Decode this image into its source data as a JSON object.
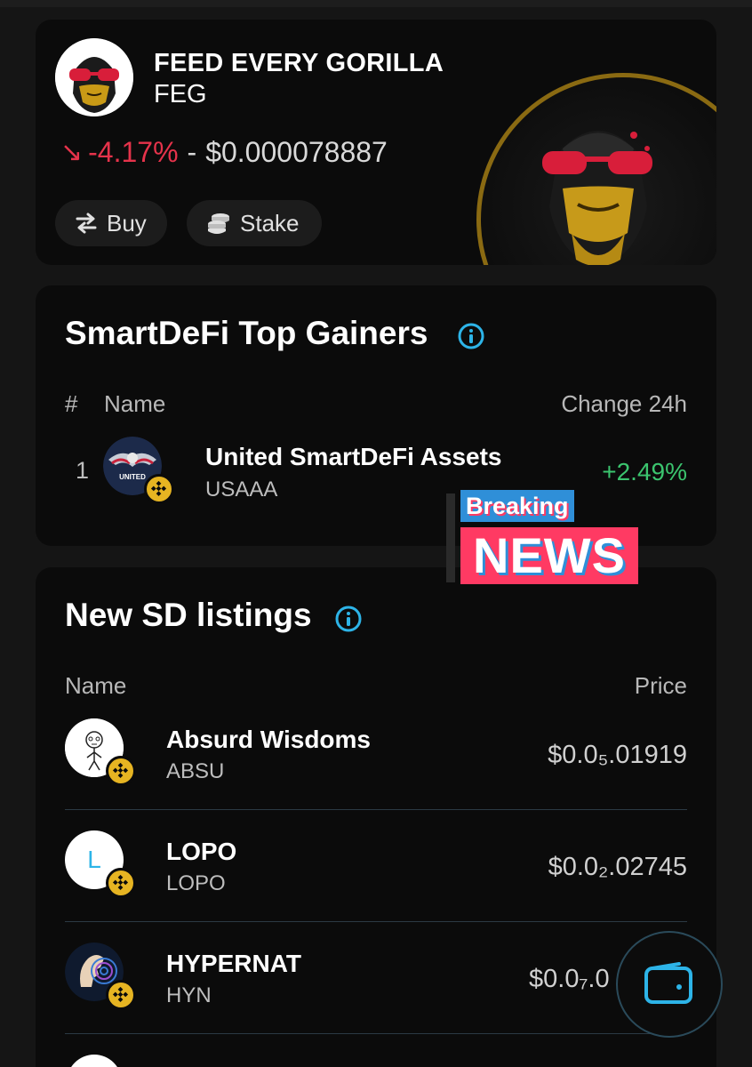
{
  "hero": {
    "name": "FEED EVERY GORILLA",
    "ticker": "FEG",
    "change_arrow": "↘",
    "change": "-4.17%",
    "separator": "-",
    "price": "$0.000078887",
    "buttons": [
      {
        "label": "Buy",
        "icon": "swap-arrows-icon"
      },
      {
        "label": "Stake",
        "icon": "coin-stack-icon"
      }
    ]
  },
  "top_gainers": {
    "title": "SmartDeFi Top Gainers",
    "headers": {
      "rank": "#",
      "name": "Name",
      "change": "Change 24h"
    },
    "rows": [
      {
        "rank": "1",
        "name": "United SmartDeFi Assets",
        "ticker": "USAAA",
        "change": "+2.49%",
        "avatar_text": "UNITED"
      }
    ]
  },
  "news_overlay": {
    "line1": "Breaking",
    "line2": "NEWS"
  },
  "new_listings": {
    "title": "New SD listings",
    "headers": {
      "name": "Name",
      "price": "Price"
    },
    "rows": [
      {
        "name": "Absurd Wisdoms",
        "ticker": "ABSU",
        "price": "$0.0₅.01919"
      },
      {
        "name": "LOPO",
        "ticker": "LOPO",
        "price": "$0.0₂.02745",
        "avatar_letter": "L"
      },
      {
        "name": "HYPERNAT",
        "ticker": "HYN",
        "price": "$0.0₇.0"
      }
    ]
  },
  "colors": {
    "negative": "#e6334b",
    "positive": "#3bc46e",
    "accent": "#2db4e8",
    "bnb": "#e6b422",
    "card": "#0b0b0b",
    "background": "#151515"
  },
  "wallet_button": {
    "icon": "wallet-icon"
  }
}
